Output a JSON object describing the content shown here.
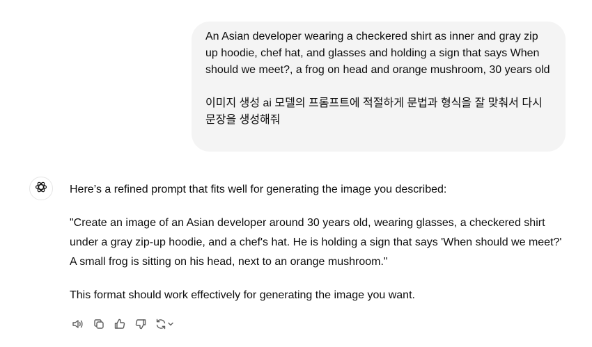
{
  "conversation": {
    "user_message": {
      "paragraph_1": "An Asian developer wearing a checkered shirt as inner and gray zip up hoodie, chef hat, and glasses and holding a sign that says When should we meet?, a frog on head and orange mushroom, 30 years old",
      "paragraph_2": "이미지 생성 ai 모델의 프롬프트에 적절하게 문법과 형식을 잘 맞춰서 다시 문장을 생성해줘"
    },
    "assistant_message": {
      "intro": "Here’s a refined prompt that fits well for generating the image you described:",
      "prompt": "\"Create an image of an Asian developer around 30 years old, wearing glasses, a checkered shirt under a gray zip-up hoodie, and a chef's hat. He is holding a sign that says 'When should we meet?' A small frog is sitting on his head, next to an orange mushroom.\"",
      "closing": "This format should work effectively for generating the image you want."
    },
    "actions": [
      {
        "icon": "speaker-icon"
      },
      {
        "icon": "copy-icon"
      },
      {
        "icon": "thumbs-up-icon"
      },
      {
        "icon": "thumbs-down-icon"
      },
      {
        "icon": "regenerate-icon"
      }
    ]
  },
  "colors": {
    "bubble_background": "#f4f4f4",
    "text": "#0d0d0d",
    "icon": "#5d5d5d"
  }
}
